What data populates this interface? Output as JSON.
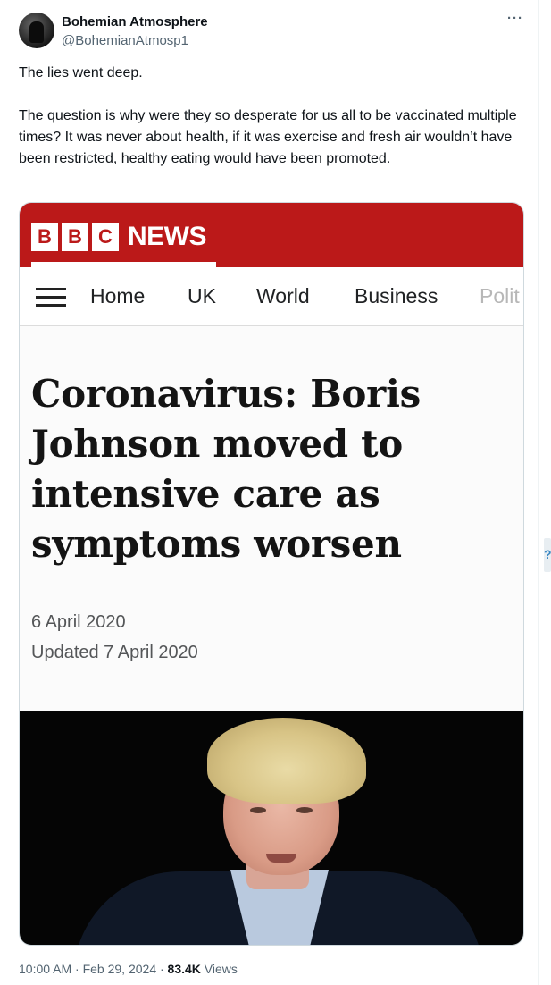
{
  "post": {
    "author": {
      "display_name": "Bohemian Atmosphere",
      "handle": "@BohemianAtmosp1",
      "avatar_icon": "avatar-photo"
    },
    "more_icon": "more-dots-icon",
    "text_line1": "The lies went deep.",
    "text_para2": "The question is why were they so desperate for us all to be vaccinated multiple times? It was never about health, if it was exercise and fresh air wouldn’t have been restricted, healthy eating would have been promoted.",
    "timestamp": "10:00 AM · Feb 29, 2024 ·",
    "views_count": "83.4K",
    "views_label": "Views"
  },
  "article": {
    "brand_letters": [
      "B",
      "B",
      "C"
    ],
    "brand_word": "NEWS",
    "brand_color": "#bb1919",
    "menu_icon": "hamburger-menu-icon",
    "nav": [
      "Home",
      "UK",
      "World",
      "Business",
      "Polit"
    ],
    "headline": "Coronavirus: Boris Johnson moved to intensive care as symptoms worsen",
    "date": "6 April 2020",
    "updated": "Updated 7 April 2020"
  }
}
